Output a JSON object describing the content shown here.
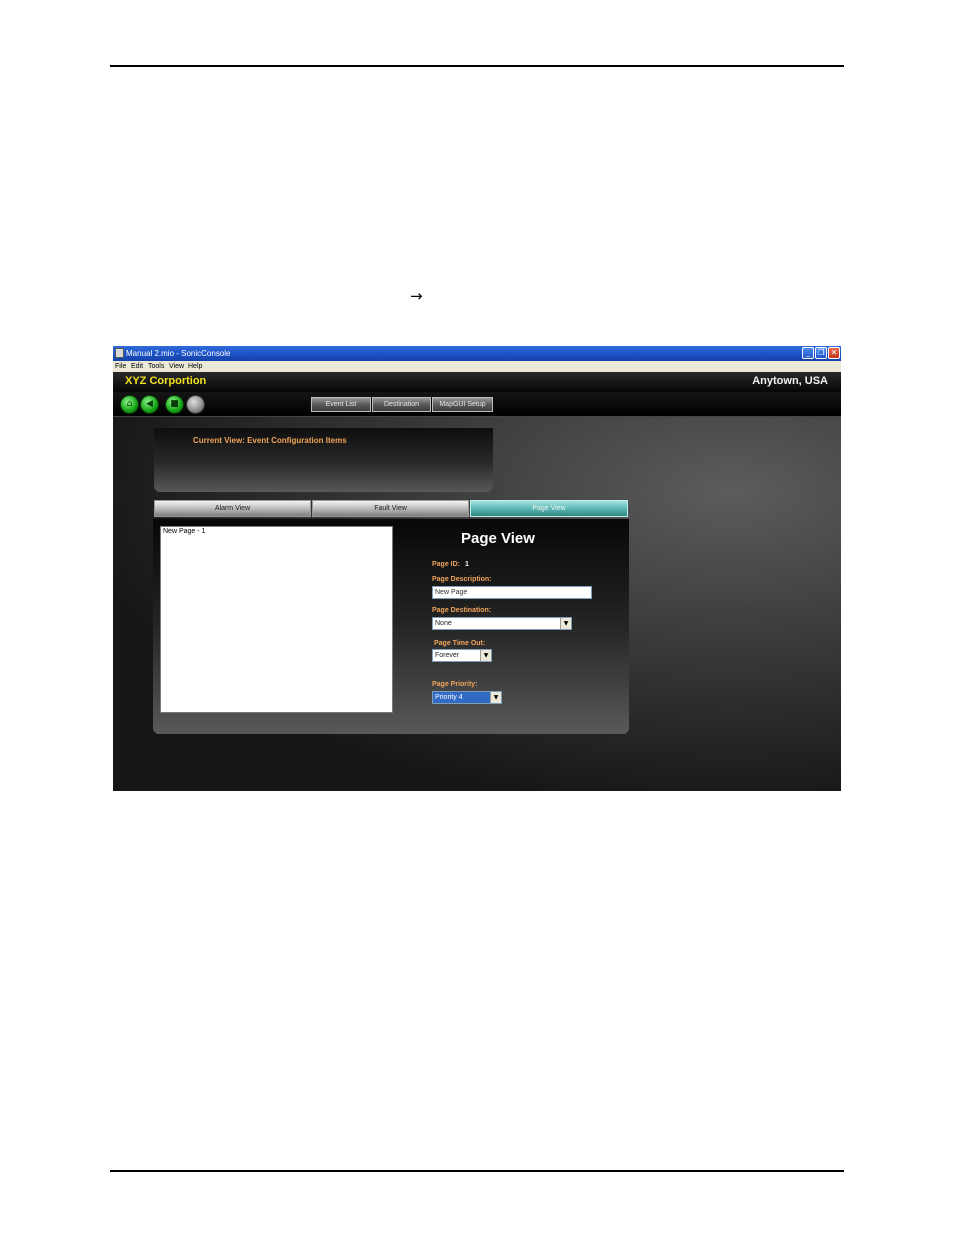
{
  "document": {
    "arrow_glyph": "→"
  },
  "window": {
    "title": "Manual 2.mio - SonicConsole",
    "buttons": {
      "minimize": "_",
      "maximize": "❐",
      "close": "✕"
    }
  },
  "menu": [
    "File",
    "Edit",
    "Tools",
    "View",
    "Help"
  ],
  "header": {
    "company": "XYZ Corportion",
    "location": "Anytown, USA"
  },
  "toolbar": {
    "icons": [
      "home-icon",
      "back-icon",
      "stop-icon",
      "disabled-icon"
    ],
    "nav": [
      "Event List",
      "Destination",
      "MapGUI Setup"
    ]
  },
  "current_view": "Current View: Event Configuration Items",
  "tabs": [
    {
      "label": "Alarm View",
      "active": false
    },
    {
      "label": "Fault View",
      "active": false
    },
    {
      "label": "Page View",
      "active": true
    }
  ],
  "page_list": [
    "New Page - 1"
  ],
  "page_view": {
    "title": "Page View",
    "page_id_label": "Page ID:",
    "page_id": "1",
    "description_label": "Page Description:",
    "description_value": "New Page",
    "destination_label": "Page Destination:",
    "destination_value": "None",
    "timeout_label": "Page Time Out:",
    "timeout_value": "Forever",
    "priority_label": "Page Priority:",
    "priority_value": "Priority 4"
  },
  "colors": {
    "company": "#f2e21c",
    "label_orange": "#f0a45a",
    "active_tab": "#5bb8b4",
    "titlebar": "#1b4fc2"
  }
}
